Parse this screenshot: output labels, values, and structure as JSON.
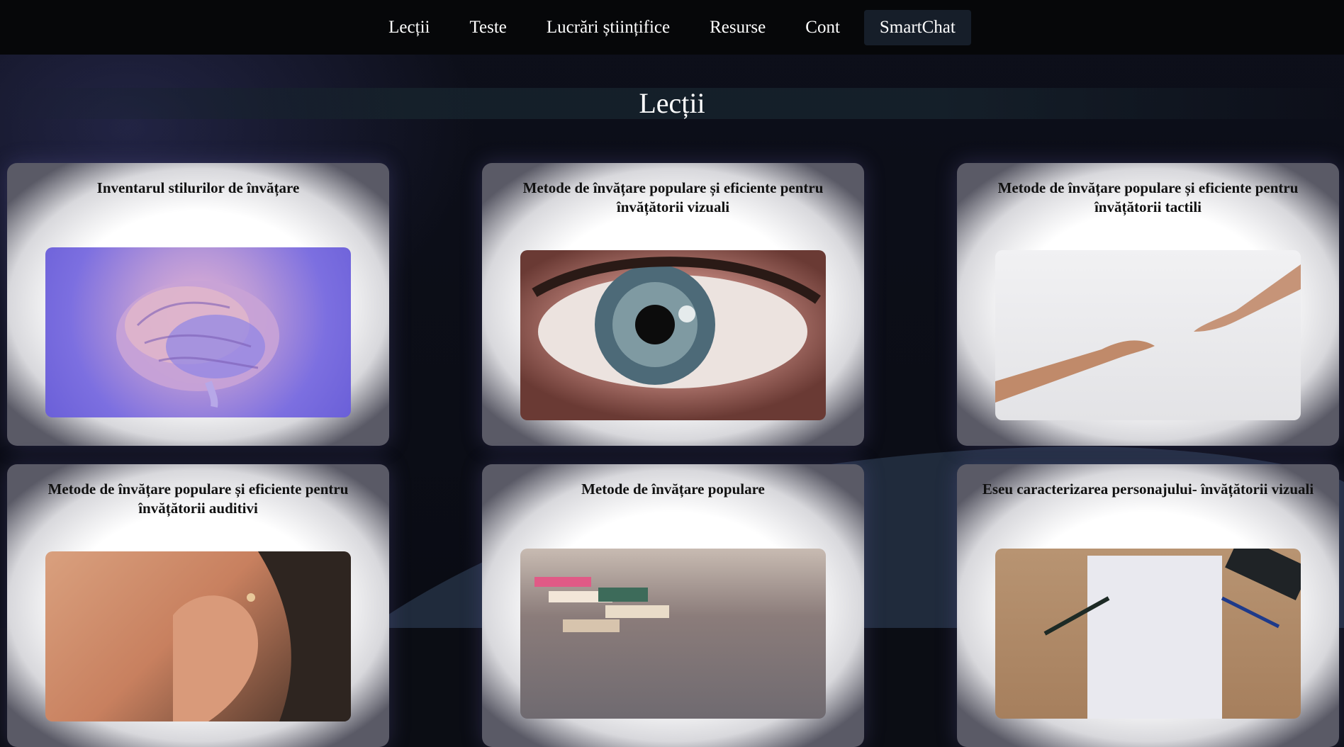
{
  "nav": {
    "items": [
      {
        "label": "Lecții",
        "active": false
      },
      {
        "label": "Teste",
        "active": false
      },
      {
        "label": "Lucrări științifice",
        "active": false
      },
      {
        "label": "Resurse",
        "active": false
      },
      {
        "label": "Cont",
        "active": false
      },
      {
        "label": "SmartChat",
        "active": true
      }
    ]
  },
  "page": {
    "title": "Lecții"
  },
  "lessons": [
    {
      "title": "Inventarul stilurilor de învățare",
      "image": "brain-image"
    },
    {
      "title": "Metode de învățare populare și eficiente pentru învățătorii vizuali",
      "image": "eye-image"
    },
    {
      "title": "Metode de învățare populare și eficiente pentru învățătorii tactili",
      "image": "hands-image"
    },
    {
      "title": "Metode de învățare populare și eficiente pentru învățătorii auditivi",
      "image": "ear-image"
    },
    {
      "title": "Metode de învățare populare",
      "image": "books-image"
    },
    {
      "title": "Eseu caracterizarea personajului- învățătorii vizuali",
      "image": "paper-pens-image"
    }
  ],
  "colors": {
    "nav_bg": "#060709",
    "nav_active_bg": "#161e29",
    "page_bg": "#0b0d14",
    "title_band": "#16222c"
  }
}
